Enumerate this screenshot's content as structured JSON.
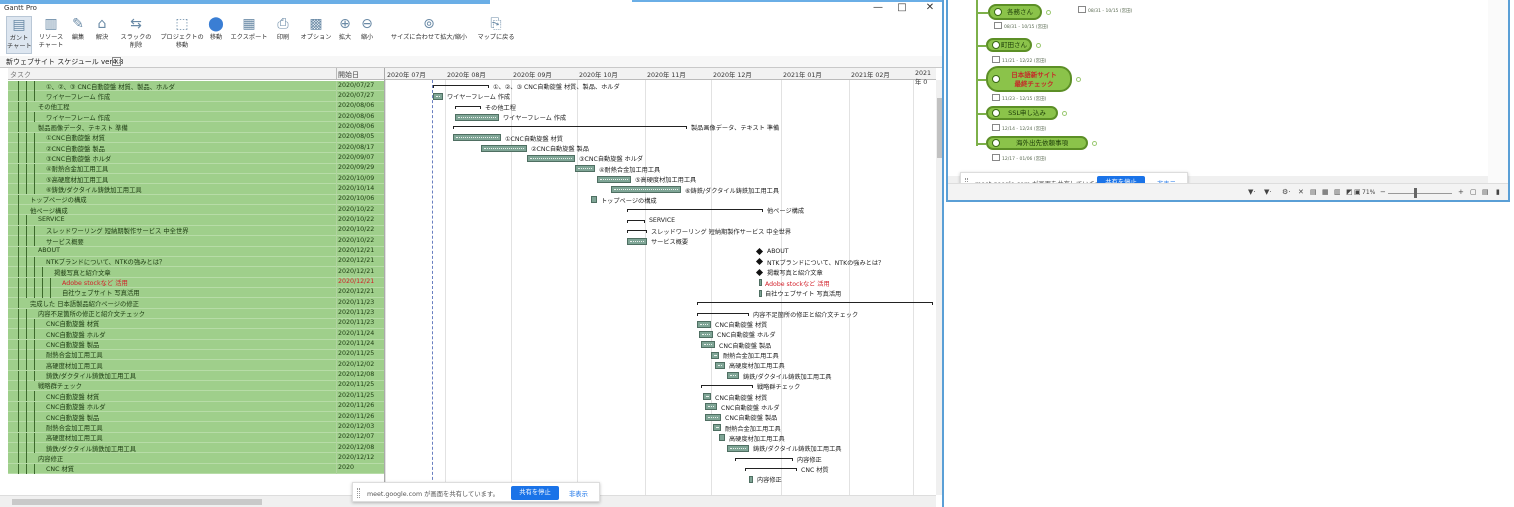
{
  "app": {
    "title": "Gantt Pro",
    "document_tab": "新ウェブサイト スケジュール ver4.8",
    "close_glyph": "x"
  },
  "window_controls": {
    "minimize": "—",
    "maximize": "□",
    "close": "✕"
  },
  "ribbon": [
    {
      "label": "ガント\nチャート",
      "icon": "gantt-chart-icon",
      "active": true
    },
    {
      "label": "リソース\nチャート",
      "icon": "resource-chart-icon"
    },
    {
      "label": "編集",
      "icon": "pencil-icon"
    },
    {
      "label": "解決",
      "icon": "home-icon"
    },
    {
      "label": "スラックの\n削除",
      "icon": "slack-remove-icon"
    },
    {
      "label": "プロジェクトの\n移動",
      "icon": "project-move-icon"
    },
    {
      "label": "移動",
      "icon": "pin-icon"
    },
    {
      "label": "エクスポート",
      "icon": "export-icon"
    },
    {
      "label": "印刷",
      "icon": "print-icon"
    },
    {
      "label": "オプション",
      "icon": "options-icon"
    },
    {
      "label": "拡大",
      "icon": "zoom-in-icon"
    },
    {
      "label": "縮小",
      "icon": "zoom-out-icon"
    },
    {
      "label": "サイズに合わせて拡大/縮小",
      "icon": "fit-size-icon"
    },
    {
      "label": "マップに戻る",
      "icon": "back-to-map-icon"
    }
  ],
  "grid": {
    "col_task": "タスク",
    "col_start": "開始日",
    "rows": [
      {
        "name": "①、②、③ CNC自動旋盤 材質、製品、ホルダ",
        "date": "2020/07/27",
        "indent": 3
      },
      {
        "name": "ワイヤーフレーム 作成",
        "date": "2020/07/27",
        "indent": 3
      },
      {
        "name": "その他工程",
        "date": "2020/08/06",
        "indent": 2
      },
      {
        "name": "ワイヤーフレーム 作成",
        "date": "2020/08/06",
        "indent": 3
      },
      {
        "name": "製品画像データ、テキスト 準備",
        "date": "2020/08/06",
        "indent": 2
      },
      {
        "name": "①CNC自動旋盤 材質",
        "date": "2020/08/05",
        "indent": 3
      },
      {
        "name": "②CNC自動旋盤 製品",
        "date": "2020/08/17",
        "indent": 3
      },
      {
        "name": "③CNC自動旋盤 ホルダ",
        "date": "2020/09/07",
        "indent": 3
      },
      {
        "name": "④耐熱合金加工用工具",
        "date": "2020/09/29",
        "indent": 3
      },
      {
        "name": "⑤高硬度材加工用工具",
        "date": "2020/10/09",
        "indent": 3
      },
      {
        "name": "⑥鋳鉄/ダクタイル鋳鉄加工用工具",
        "date": "2020/10/14",
        "indent": 3
      },
      {
        "name": "トップページの構成",
        "date": "2020/10/06",
        "indent": 1
      },
      {
        "name": "他ページ構成",
        "date": "2020/10/22",
        "indent": 1
      },
      {
        "name": "SERVICE",
        "date": "2020/10/22",
        "indent": 2
      },
      {
        "name": "スレッドワーリング 短納期製作サービス 中全世界",
        "date": "2020/10/22",
        "indent": 3
      },
      {
        "name": "サービス概要",
        "date": "2020/10/22",
        "indent": 3
      },
      {
        "name": "ABOUT",
        "date": "2020/12/21",
        "indent": 2
      },
      {
        "name": "NTKブランドについて、NTKの強みとは？",
        "date": "2020/12/21",
        "indent": 3
      },
      {
        "name": "掲載写真と紹介文章",
        "date": "2020/12/21",
        "indent": 4
      },
      {
        "name": "Adobe stockなど 活用",
        "date": "2020/12/21",
        "indent": 5,
        "red": true
      },
      {
        "name": "自社ウェブサイト 写真活用",
        "date": "2020/12/21",
        "indent": 5
      },
      {
        "name": "完成した 日本語製品紹介ページの修正",
        "date": "2020/11/23",
        "indent": 1
      },
      {
        "name": "内容不足箇所の修正と紹介文チェック",
        "date": "2020/11/23",
        "indent": 2
      },
      {
        "name": "CNC自動旋盤 材質",
        "date": "2020/11/23",
        "indent": 3
      },
      {
        "name": "CNC自動旋盤 ホルダ",
        "date": "2020/11/24",
        "indent": 3
      },
      {
        "name": "CNC自動旋盤 製品",
        "date": "2020/11/24",
        "indent": 3
      },
      {
        "name": "耐熱合金加工用工具",
        "date": "2020/11/25",
        "indent": 3
      },
      {
        "name": "高硬度材加工用工具",
        "date": "2020/12/02",
        "indent": 3
      },
      {
        "name": "鋳鉄/ダクタイル鋳鉄加工用工具",
        "date": "2020/12/08",
        "indent": 3
      },
      {
        "name": "戦略群チェック",
        "date": "2020/11/25",
        "indent": 2
      },
      {
        "name": "CNC自動旋盤 材質",
        "date": "2020/11/25",
        "indent": 3
      },
      {
        "name": "CNC自動旋盤 ホルダ",
        "date": "2020/11/26",
        "indent": 3
      },
      {
        "name": "CNC自動旋盤 製品",
        "date": "2020/11/26",
        "indent": 3
      },
      {
        "name": "耐熱合金加工用工具",
        "date": "2020/12/03",
        "indent": 3
      },
      {
        "name": "高硬度材加工用工具",
        "date": "2020/12/07",
        "indent": 3
      },
      {
        "name": "鋳鉄/ダクタイル鋳鉄加工用工具",
        "date": "2020/12/08",
        "indent": 3
      },
      {
        "name": "内容修正",
        "date": "2020/12/12",
        "indent": 2
      },
      {
        "name": "CNC 材質",
        "date": "2020",
        "indent": 3
      }
    ]
  },
  "chart": {
    "months": [
      "2020年 07月",
      "2020年 08月",
      "2020年 09月",
      "2020年 10月",
      "2020年 11月",
      "2020年 12月",
      "2021年 01月",
      "2021年 02月",
      "2021年 0"
    ],
    "items": [
      {
        "row": 0,
        "kind": "brace",
        "label": "①、②、③ CNC自動旋盤 材質、製品、ホルダ"
      },
      {
        "row": 1,
        "kind": "bar",
        "label": "ワイヤーフレーム 作成"
      },
      {
        "row": 2,
        "kind": "brace",
        "label": "その他工程"
      },
      {
        "row": 3,
        "kind": "bar",
        "label": "ワイヤーフレーム 作成"
      },
      {
        "row": 4,
        "kind": "brace",
        "label": "製品画像データ、テキスト 準備"
      },
      {
        "row": 5,
        "kind": "bar",
        "label": "①CNC自動旋盤 材質"
      },
      {
        "row": 6,
        "kind": "bar",
        "label": "②CNC自動旋盤 製品"
      },
      {
        "row": 7,
        "kind": "bar",
        "label": "③CNC自動旋盤 ホルダ"
      },
      {
        "row": 8,
        "kind": "bar",
        "label": "④耐熱合金加工用工具"
      },
      {
        "row": 9,
        "kind": "bar",
        "label": "⑤高硬度材加工用工具"
      },
      {
        "row": 10,
        "kind": "bar",
        "label": "⑥鋳鉄/ダクタイル鋳鉄加工用工具"
      },
      {
        "row": 11,
        "kind": "bar",
        "label": "トップページの構成"
      },
      {
        "row": 12,
        "kind": "brace",
        "label": "他ページ構成"
      },
      {
        "row": 13,
        "kind": "brace",
        "label": "SERVICE"
      },
      {
        "row": 14,
        "kind": "brace",
        "label": "スレッドワーリング 短納期製作サービス 中全世界"
      },
      {
        "row": 15,
        "kind": "bar",
        "label": "サービス概要"
      },
      {
        "row": 16,
        "kind": "diamond",
        "label": "ABOUT"
      },
      {
        "row": 17,
        "kind": "diamond",
        "label": "NTKブランドについて、NTKの強みとは？"
      },
      {
        "row": 18,
        "kind": "diamond",
        "label": "掲載写真と紹介文章"
      },
      {
        "row": 19,
        "kind": "bar",
        "label": "Adobe stockなど 活用",
        "red": true
      },
      {
        "row": 20,
        "kind": "bar",
        "label": "自社ウェブサイト 写真活用"
      },
      {
        "row": 21,
        "kind": "brace",
        "label": "完成した 日本語製品紹介ページの修正"
      },
      {
        "row": 22,
        "kind": "brace",
        "label": "内容不足箇所の修正と紹介文チェック"
      },
      {
        "row": 23,
        "kind": "bar",
        "label": "CNC自動旋盤 材質"
      },
      {
        "row": 24,
        "kind": "bar",
        "label": "CNC自動旋盤 ホルダ"
      },
      {
        "row": 25,
        "kind": "bar",
        "label": "CNC自動旋盤 製品"
      },
      {
        "row": 26,
        "kind": "bar",
        "label": "耐熱合金加工用工具"
      },
      {
        "row": 27,
        "kind": "bar",
        "label": "高硬度材加工用工具"
      },
      {
        "row": 28,
        "kind": "bar",
        "label": "鋳鉄/ダクタイル鋳鉄加工用工具"
      },
      {
        "row": 29,
        "kind": "brace",
        "label": "戦略群チェック"
      },
      {
        "row": 30,
        "kind": "bar",
        "label": "CNC自動旋盤 材質"
      },
      {
        "row": 31,
        "kind": "bar",
        "label": "CNC自動旋盤 ホルダ"
      },
      {
        "row": 32,
        "kind": "bar",
        "label": "CNC自動旋盤 製品"
      },
      {
        "row": 33,
        "kind": "bar",
        "label": "耐熱合金加工用工具"
      },
      {
        "row": 34,
        "kind": "bar",
        "label": "高硬度材加工用工具"
      },
      {
        "row": 35,
        "kind": "bar",
        "label": "鋳鉄/ダクタイル鋳鉄加工用工具"
      },
      {
        "row": 36,
        "kind": "brace",
        "label": "内容修正"
      },
      {
        "row": 37,
        "kind": "brace",
        "label": "CNC 材質"
      },
      {
        "row": 38,
        "kind": "bar",
        "label": "内容修正"
      }
    ]
  },
  "share_banner": {
    "message": "meet.google.com が画面を共有しています。",
    "stop_label": "共有を停止",
    "hide_label": "非表示"
  },
  "mindmap": {
    "nodes": [
      {
        "label": "各務さん",
        "meta": "08/31 - 10/15  (宮田)"
      },
      {
        "label": "町田さん",
        "meta": "11/21 - 12/22  (宮田)"
      },
      {
        "label": "日本語新サイト\n最終チェック",
        "meta": "11/23 - 12/15  (宮田)",
        "red": true
      },
      {
        "label": "SSL申し込み",
        "meta": "12/14 - 12/24  (宮田)"
      },
      {
        "label": "海外出先依頼事項",
        "meta": "12/17 - 01/06  (宮田)"
      }
    ],
    "top_meta": "08/31 - 10/15  (宮田)",
    "zoom": "71%",
    "plus": "+",
    "minus": "−",
    "share_message": "meet.google.com が画面を共有しています。",
    "share_stop": "共有を停止",
    "share_hide": "非表示"
  }
}
